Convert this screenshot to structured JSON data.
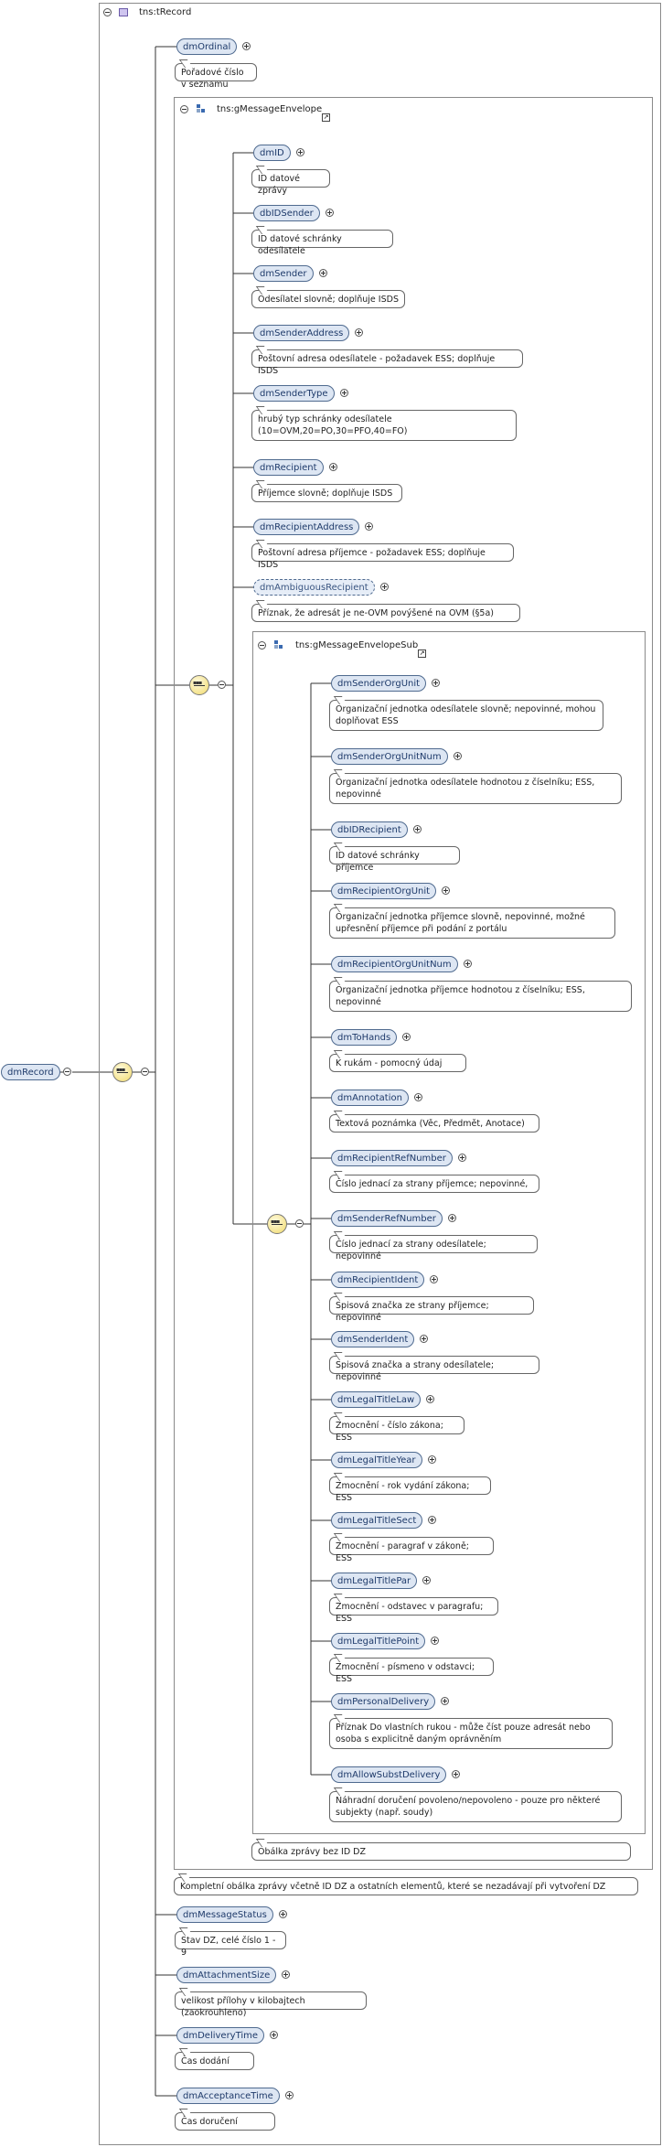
{
  "root_type": "tns:tRecord",
  "root_element": "dmRecord",
  "envelope_group": "tns:gMessageEnvelope",
  "envelope_sub_group": "tns:gMessageEnvelopeSub",
  "top_elements": [
    {
      "name": "dmOrdinal",
      "doc": "Pořadové číslo v seznamu"
    }
  ],
  "envelope_elements": [
    {
      "name": "dmID",
      "doc": "ID datové zprávy"
    },
    {
      "name": "dbIDSender",
      "doc": "ID datové schránky odesílatele"
    },
    {
      "name": "dmSender",
      "doc": "Odesílatel slovně; doplňuje ISDS"
    },
    {
      "name": "dmSenderAddress",
      "doc": "Poštovní adresa odesílatele - požadavek ESS; doplňuje ISDS"
    },
    {
      "name": "dmSenderType",
      "doc": "hrubý typ schránky odesílatele (10=OVM,20=PO,30=PFO,40=FO)"
    },
    {
      "name": "dmRecipient",
      "doc": "Příjemce slovně; doplňuje ISDS"
    },
    {
      "name": "dmRecipientAddress",
      "doc": "Poštovní adresa příjemce - požadavek ESS; doplňuje ISDS"
    },
    {
      "name": "dmAmbiguousRecipient",
      "doc": "Příznak, že adresát je ne-OVM povýšené na OVM (§5a)"
    }
  ],
  "sub_elements": [
    {
      "name": "dmSenderOrgUnit",
      "doc": "Organizační jednotka odesílatele slovně; nepovinné, mohou doplňovat ESS"
    },
    {
      "name": "dmSenderOrgUnitNum",
      "doc": "Organizační jednotka odesílatele hodnotou z číselníku; ESS, nepovinné"
    },
    {
      "name": "dbIDRecipient",
      "doc": "ID datové schránky příjemce"
    },
    {
      "name": "dmRecipientOrgUnit",
      "doc": "Organizační jednotka příjemce slovně, nepovinné, možné upřesnění příjemce při podání z portálu"
    },
    {
      "name": "dmRecipientOrgUnitNum",
      "doc": "Organizační jednotka příjemce hodnotou z číselníku; ESS, nepovinné"
    },
    {
      "name": "dmToHands",
      "doc": "K rukám - pomocný údaj"
    },
    {
      "name": "dmAnnotation",
      "doc": "Textová poznámka (Věc, Předmět, Anotace)"
    },
    {
      "name": "dmRecipientRefNumber",
      "doc": "Číslo jednací za strany příjemce; nepovinné,"
    },
    {
      "name": "dmSenderRefNumber",
      "doc": "Číslo jednací za strany odesílatele; nepovinné"
    },
    {
      "name": "dmRecipientIdent",
      "doc": "Spisová značka ze strany příjemce; nepovinné"
    },
    {
      "name": "dmSenderIdent",
      "doc": "Spisová značka a strany odesílatele; nepovinné"
    },
    {
      "name": "dmLegalTitleLaw",
      "doc": "Zmocnění - číslo zákona; ESS"
    },
    {
      "name": "dmLegalTitleYear",
      "doc": "Zmocnění - rok vydání zákona; ESS"
    },
    {
      "name": "dmLegalTitleSect",
      "doc": "Zmocnění - paragraf v zákoně; ESS"
    },
    {
      "name": "dmLegalTitlePar",
      "doc": "Zmocnění - odstavec v paragrafu; ESS"
    },
    {
      "name": "dmLegalTitlePoint",
      "doc": "Zmocnění - písmeno v odstavci; ESS"
    },
    {
      "name": "dmPersonalDelivery",
      "doc": "Příznak Do vlastních rukou - může číst pouze adresát nebo osoba s explicitně daným oprávněním"
    },
    {
      "name": "dmAllowSubstDelivery",
      "doc": "Náhradní doručení povoleno/nepovoleno - pouze pro některé subjekty (např. soudy)"
    }
  ],
  "sub_group_doc": "Obálka zprávy bez ID DZ",
  "envelope_group_doc": "Kompletní obálka zprávy včetně ID DZ a ostatních elementů, které se nezadávají při vytvoření DZ",
  "bottom_elements": [
    {
      "name": "dmMessageStatus",
      "doc": "Stav DZ, celé číslo 1 - 9"
    },
    {
      "name": "dmAttachmentSize",
      "doc": "velikost přílohy v kilobajtech (zaokrouhleno)"
    },
    {
      "name": "dmDeliveryTime",
      "doc": "Čas dodání"
    },
    {
      "name": "dmAcceptanceTime",
      "doc": "Čas doručení"
    }
  ]
}
